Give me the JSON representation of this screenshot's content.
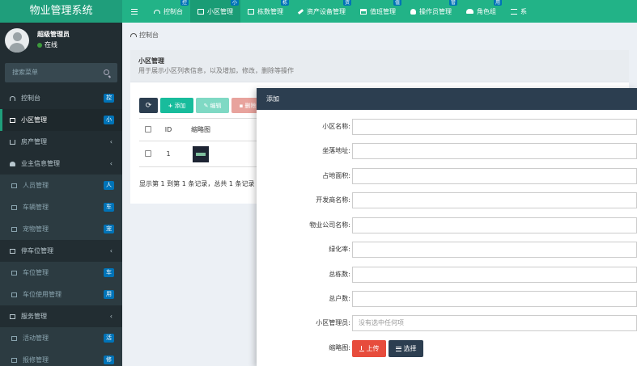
{
  "app": {
    "title": "物业管理系统"
  },
  "topnav": {
    "tabs": [
      {
        "label": "控制台",
        "badge": "控"
      },
      {
        "label": "小区管理",
        "badge": "小"
      },
      {
        "label": "栋数管理",
        "badge": "栋"
      },
      {
        "label": "资产设备管理",
        "badge": "资"
      },
      {
        "label": "值班管理",
        "badge": "值"
      },
      {
        "label": "操作员管理",
        "badge": "管"
      },
      {
        "label": "角色组",
        "badge": "用"
      },
      {
        "label": "系"
      }
    ]
  },
  "user": {
    "name": "超级管理员",
    "status": "在线"
  },
  "search": {
    "placeholder": "搜索菜单"
  },
  "menu": {
    "items": [
      {
        "label": "控制台",
        "badge": "控"
      },
      {
        "label": "小区管理",
        "badge": "小"
      },
      {
        "label": "房产管理",
        "chevron": "‹"
      },
      {
        "label": "业主信息管理",
        "chevron": "‹"
      },
      {
        "label": "人员管理",
        "badge": "人"
      },
      {
        "label": "车辆管理",
        "badge": "车"
      },
      {
        "label": "宠物管理",
        "badge": "宠"
      },
      {
        "label": "停车位管理",
        "chevron": "‹"
      },
      {
        "label": "车位管理",
        "badge": "车"
      },
      {
        "label": "车位使用管理",
        "badge": "用"
      },
      {
        "label": "服务管理",
        "chevron": "‹"
      },
      {
        "label": "活动管理",
        "badge": "活"
      },
      {
        "label": "报修管理",
        "badge": "修"
      }
    ]
  },
  "breadcrumb": "控制台",
  "panel": {
    "title": "小区管理",
    "description": "用于展示小区列表信息，以及增加，修改，删除等操作"
  },
  "toolbar": {
    "add": "添加",
    "edit": "编辑",
    "delete": "删除"
  },
  "table": {
    "headers": [
      "ID",
      "缩略图"
    ],
    "rows": [
      {
        "id": "1",
        "code": "CM"
      }
    ]
  },
  "pagination": {
    "info": "显示第 1 到第 1 条记录，总共 1 条记录"
  },
  "modal": {
    "title": "添加",
    "fields": [
      {
        "label": "小区名称:",
        "value": ""
      },
      {
        "label": "坐落地址:",
        "value": ""
      },
      {
        "label": "占地面积:",
        "value": ""
      },
      {
        "label": "开发商名称:",
        "value": ""
      },
      {
        "label": "物业公司名称:",
        "value": ""
      },
      {
        "label": "绿化率:",
        "value": ""
      },
      {
        "label": "总栋数:",
        "value": ""
      },
      {
        "label": "总户数:",
        "value": ""
      },
      {
        "label": "小区管理员:",
        "value": "没有选中任何项"
      }
    ],
    "thumbnail_label": "缩略图:",
    "upload_label": "上传",
    "choose_label": "选择"
  }
}
